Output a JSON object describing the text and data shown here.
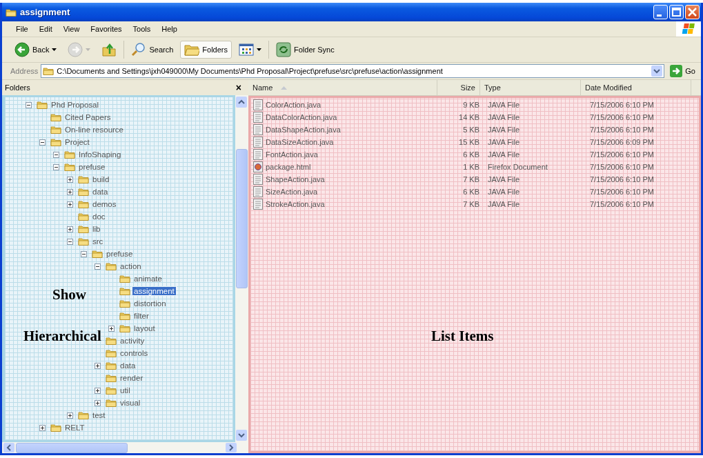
{
  "window": {
    "title": "assignment"
  },
  "menu": [
    "File",
    "Edit",
    "View",
    "Favorites",
    "Tools",
    "Help"
  ],
  "toolbar": [
    {
      "kind": "back",
      "label": "Back",
      "selected": false,
      "disabled": false
    },
    {
      "kind": "forward",
      "selected": false,
      "disabled": true
    },
    {
      "kind": "up",
      "selected": false,
      "disabled": false
    },
    {
      "kind": "search",
      "label": "Search",
      "selected": false,
      "disabled": false
    },
    {
      "kind": "folders",
      "label": "Folders",
      "selected": true,
      "disabled": false
    },
    {
      "kind": "views",
      "selected": false,
      "disabled": false
    },
    {
      "kind": "sync",
      "label": "Folder Sync",
      "selected": false,
      "disabled": false
    }
  ],
  "address": {
    "label": "Address",
    "value": "C:\\Documents and Settings\\jxh049000\\My Documents\\Phd Proposal\\Project\\prefuse\\src\\prefuse\\action\\assignment",
    "go": "Go"
  },
  "folders_pane": {
    "title": "Folders",
    "close": "×",
    "tree": [
      {
        "label": "Phd Proposal",
        "kind": "expanded",
        "selected": false,
        "children": [
          {
            "label": "Cited Papers",
            "kind": "leaf",
            "selected": false
          },
          {
            "label": "On-line resource",
            "kind": "leaf",
            "selected": false
          },
          {
            "label": "Project",
            "kind": "expanded",
            "selected": false,
            "children": [
              {
                "label": "InfoShaping",
                "kind": "expanded",
                "selected": false
              },
              {
                "label": "prefuse",
                "kind": "expanded",
                "selected": false,
                "children": [
                  {
                    "label": "build",
                    "kind": "collapsed",
                    "selected": false
                  },
                  {
                    "label": "data",
                    "kind": "collapsed",
                    "selected": false
                  },
                  {
                    "label": "demos",
                    "kind": "collapsed",
                    "selected": false
                  },
                  {
                    "label": "doc",
                    "kind": "leaf",
                    "selected": false
                  },
                  {
                    "label": "lib",
                    "kind": "collapsed",
                    "selected": false
                  },
                  {
                    "label": "src",
                    "kind": "expanded",
                    "selected": false,
                    "children": [
                      {
                        "label": "prefuse",
                        "kind": "expanded",
                        "selected": false,
                        "children": [
                          {
                            "label": "action",
                            "kind": "expanded",
                            "selected": false,
                            "children": [
                              {
                                "label": "animate",
                                "kind": "leaf",
                                "selected": false
                              },
                              {
                                "label": "assignment",
                                "kind": "leaf",
                                "selected": true
                              },
                              {
                                "label": "distortion",
                                "kind": "leaf",
                                "selected": false
                              },
                              {
                                "label": "filter",
                                "kind": "leaf",
                                "selected": false
                              },
                              {
                                "label": "layout",
                                "kind": "collapsed",
                                "selected": false
                              }
                            ]
                          },
                          {
                            "label": "activity",
                            "kind": "leaf",
                            "selected": false
                          },
                          {
                            "label": "controls",
                            "kind": "leaf",
                            "selected": false
                          },
                          {
                            "label": "data",
                            "kind": "collapsed",
                            "selected": false
                          },
                          {
                            "label": "render",
                            "kind": "leaf",
                            "selected": false
                          },
                          {
                            "label": "util",
                            "kind": "collapsed",
                            "selected": false
                          },
                          {
                            "label": "visual",
                            "kind": "collapsed",
                            "selected": false
                          }
                        ]
                      }
                    ]
                  },
                  {
                    "label": "test",
                    "kind": "collapsed",
                    "selected": false
                  }
                ]
              }
            ]
          },
          {
            "label": "RELT",
            "kind": "collapsed",
            "selected": false
          }
        ]
      }
    ]
  },
  "file_list": {
    "columns": [
      {
        "label": "Name",
        "sorted": true
      },
      {
        "label": "Size",
        "sorted": false
      },
      {
        "label": "Type",
        "sorted": false
      },
      {
        "label": "Date Modified",
        "sorted": false
      }
    ],
    "rows": [
      {
        "kind": "java",
        "name": "ColorAction.java",
        "size": "9 KB",
        "type": "JAVA File",
        "modified": "7/15/2006 6:10 PM"
      },
      {
        "kind": "java",
        "name": "DataColorAction.java",
        "size": "14 KB",
        "type": "JAVA File",
        "modified": "7/15/2006 6:10 PM"
      },
      {
        "kind": "java",
        "name": "DataShapeAction.java",
        "size": "5 KB",
        "type": "JAVA File",
        "modified": "7/15/2006 6:10 PM"
      },
      {
        "kind": "java",
        "name": "DataSizeAction.java",
        "size": "15 KB",
        "type": "JAVA File",
        "modified": "7/15/2006 6:09 PM"
      },
      {
        "kind": "java",
        "name": "FontAction.java",
        "size": "6 KB",
        "type": "JAVA File",
        "modified": "7/15/2006 6:10 PM"
      },
      {
        "kind": "html",
        "name": "package.html",
        "size": "1 KB",
        "type": "Firefox Document",
        "modified": "7/15/2006 6:10 PM"
      },
      {
        "kind": "java",
        "name": "ShapeAction.java",
        "size": "7 KB",
        "type": "JAVA File",
        "modified": "7/15/2006 6:10 PM"
      },
      {
        "kind": "java",
        "name": "SizeAction.java",
        "size": "6 KB",
        "type": "JAVA File",
        "modified": "7/15/2006 6:10 PM"
      },
      {
        "kind": "java",
        "name": "StrokeAction.java",
        "size": "7 KB",
        "type": "JAVA File",
        "modified": "7/15/2006 6:10 PM"
      }
    ]
  },
  "annotations": [
    {
      "text": "Show",
      "kind": "upper"
    },
    {
      "text": "Hierarchical",
      "kind": "lower"
    },
    {
      "text": "List Items",
      "kind": "list"
    }
  ]
}
